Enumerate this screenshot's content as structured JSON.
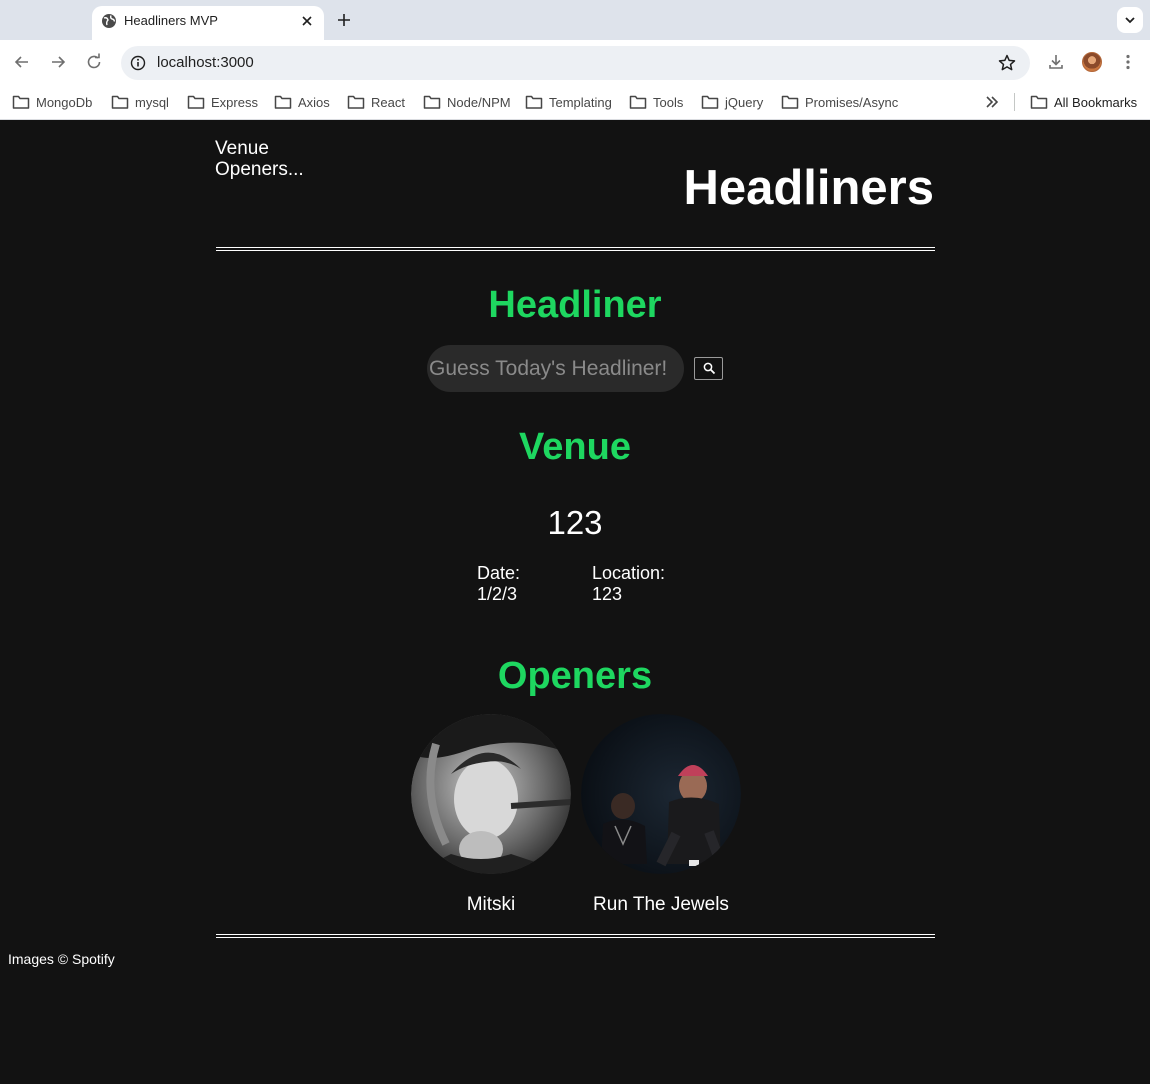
{
  "browser": {
    "tab_title": "Headliners MVP",
    "url": "localhost:3000",
    "bookmarks": [
      "MongoDb",
      "mysql",
      "Express",
      "Axios",
      "React",
      "Node/NPM",
      "Templating",
      "Tools",
      "jQuery",
      "Promises/Async"
    ],
    "all_bookmarks_label": "All Bookmarks"
  },
  "nav": {
    "venue_link": "Venue",
    "openers_link": "Openers..."
  },
  "site_title": "Headliners",
  "headliner": {
    "heading": "Headliner",
    "search_placeholder": "Guess Today's Headliner!"
  },
  "venue": {
    "heading": "Venue",
    "name": "123",
    "date_label": "Date:",
    "date_value": "1/2/3",
    "location_label": "Location:",
    "location_value": "123"
  },
  "openers": {
    "heading": "Openers",
    "items": [
      {
        "name": "Mitski"
      },
      {
        "name": "Run The Jewels"
      }
    ]
  },
  "footer_credit": "Images © Spotify",
  "colors": {
    "accent_green": "#1ed760",
    "page_background": "#121212",
    "text": "#ffffff"
  }
}
